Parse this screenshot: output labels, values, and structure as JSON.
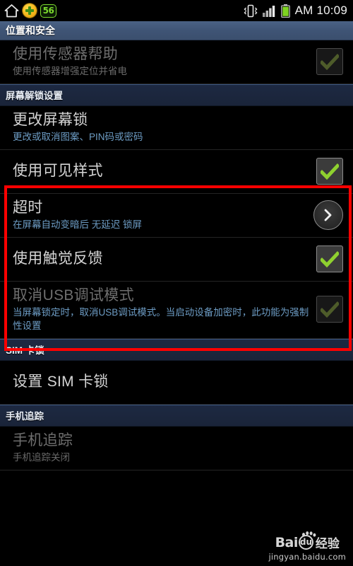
{
  "statusbar": {
    "icons": [
      "home-icon",
      "booster-plus-icon",
      "notification-count-badge",
      "vibrate-icon",
      "signal-bars-icon",
      "battery-icon"
    ],
    "count_badge": "56",
    "clock": "AM 10:09"
  },
  "titlebar": {
    "title": "位置和安全"
  },
  "sections": [
    {
      "header": null,
      "rows": [
        {
          "name": "use-sensor-aiding",
          "title": "使用传感器帮助",
          "subtitle": "使用传感器增强定位并省电",
          "subtitle_style": "gray",
          "disabled": true,
          "accessory": "checkbox",
          "checked": true
        }
      ]
    },
    {
      "header": "屏幕解锁设置",
      "rows": [
        {
          "name": "change-screen-lock",
          "title": "更改屏幕锁",
          "subtitle": "更改或取消图案、PIN码或密码",
          "subtitle_style": "blue",
          "disabled": false,
          "accessory": "none",
          "checked": false
        },
        {
          "name": "use-visible-pattern",
          "title": "使用可见样式",
          "subtitle": "",
          "subtitle_style": "blue",
          "disabled": false,
          "accessory": "checkbox",
          "checked": true
        },
        {
          "name": "lock-timeout",
          "title": "超时",
          "subtitle": "在屏幕自动变暗后 无延迟 锁屏",
          "subtitle_style": "blue",
          "disabled": false,
          "accessory": "chevron",
          "checked": false
        },
        {
          "name": "use-haptic-feedback",
          "title": "使用触觉反馈",
          "subtitle": "",
          "subtitle_style": "blue",
          "disabled": false,
          "accessory": "checkbox",
          "checked": true
        },
        {
          "name": "cancel-usb-debugging",
          "title": "取消USB调试模式",
          "subtitle": "当屏幕锁定时，取消USB调试模式。当启动设备加密时，此功能为强制性设置",
          "subtitle_style": "blue",
          "disabled": true,
          "accessory": "checkbox",
          "checked": true
        }
      ]
    },
    {
      "header": "SIM 卡锁",
      "rows": [
        {
          "name": "set-up-sim-card-lock",
          "title": "设置 SIM 卡锁",
          "subtitle": "",
          "subtitle_style": "blue",
          "disabled": false,
          "accessory": "none",
          "checked": false
        }
      ]
    },
    {
      "header": "手机追踪",
      "rows": [
        {
          "name": "phone-tracker",
          "title": "手机追踪",
          "subtitle": "手机追踪关闭",
          "subtitle_style": "gray",
          "disabled": true,
          "accessory": "none",
          "checked": false
        }
      ]
    }
  ],
  "highlight": {
    "name": "red-highlight-box",
    "color": "#ff0000"
  },
  "watermark": {
    "brand": "Bai",
    "badge": "du",
    "suffix": "经验",
    "url": "jingyan.baidu.com"
  },
  "colors": {
    "background": "#000000",
    "title_bar": "#3f5475",
    "section_header": "#1d2942",
    "accent_blue_text": "#6d9cc4",
    "check_green": "#8fd12f",
    "highlight_red": "#ff0000"
  }
}
